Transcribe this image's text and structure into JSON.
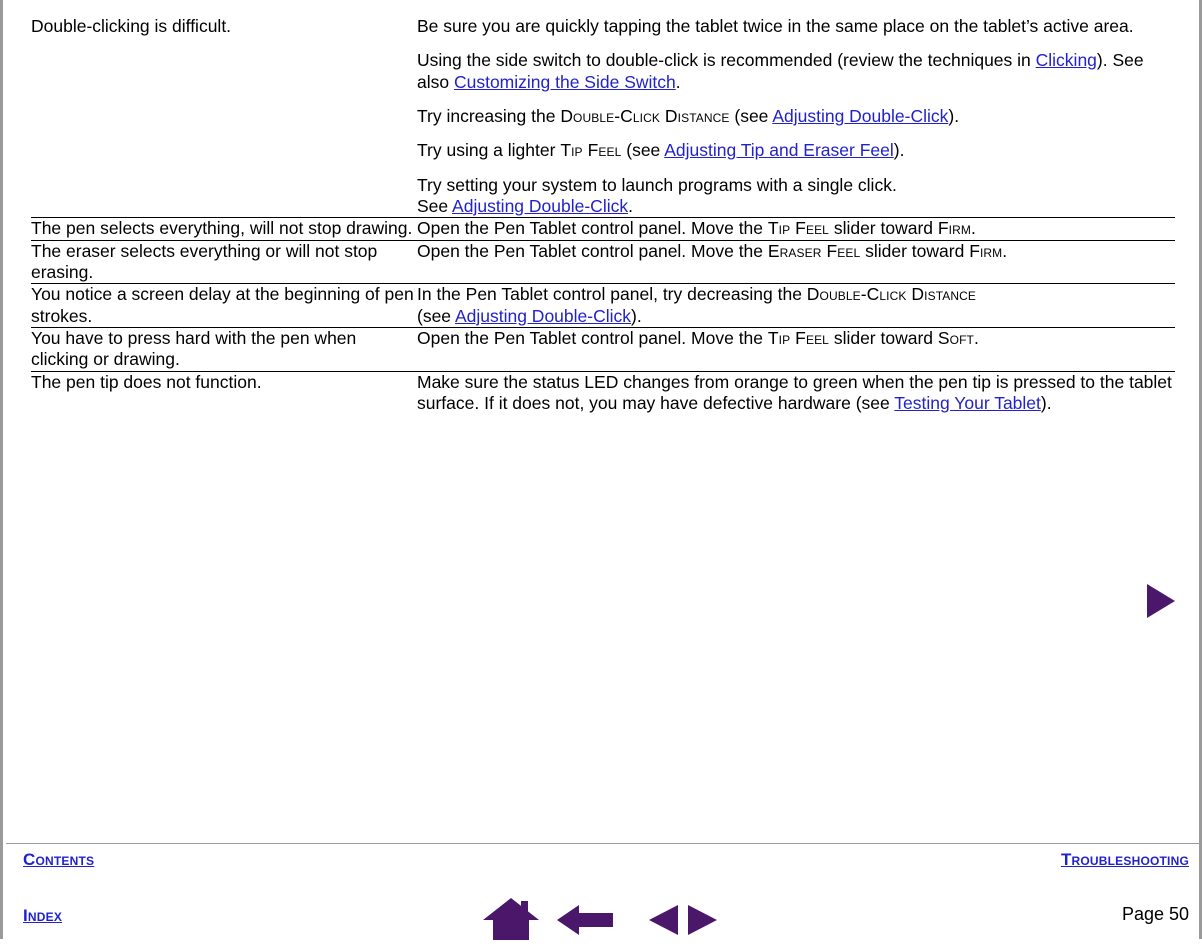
{
  "document": {
    "page_number_label": "Page  50",
    "accent_purple": "#4b176b",
    "link_blue": "#2222cc",
    "border_gray": "#9a9a9a"
  },
  "table": {
    "rows": [
      {
        "symptom": "Double-clicking is difficult.",
        "solutions": [
          {
            "segments": [
              {
                "type": "text",
                "text": "Be sure you are quickly tapping the tablet twice in the same place on the tablet’s active area."
              }
            ]
          },
          {
            "segments": [
              {
                "type": "text",
                "text": "Using the side switch to double-click is recommended (review the techniques in "
              },
              {
                "type": "link",
                "text": "Clicking"
              },
              {
                "type": "text",
                "text": ").  See also "
              },
              {
                "type": "link",
                "text": "Customizing the Side Switch"
              },
              {
                "type": "text",
                "text": "."
              }
            ]
          },
          {
            "segments": [
              {
                "type": "text",
                "text": "Try increasing the "
              },
              {
                "type": "smallcaps",
                "text": "Double-Click Distance"
              },
              {
                "type": "text",
                "text": " (see "
              },
              {
                "type": "link",
                "text": "Adjusting Double-Click"
              },
              {
                "type": "text",
                "text": ")."
              }
            ]
          },
          {
            "segments": [
              {
                "type": "text",
                "text": "Try using a lighter "
              },
              {
                "type": "smallcaps",
                "text": "Tip Feel"
              },
              {
                "type": "text",
                "text": " (see "
              },
              {
                "type": "link",
                "text": "Adjusting Tip and Eraser Feel"
              },
              {
                "type": "text",
                "text": ")."
              }
            ]
          },
          {
            "segments": [
              {
                "type": "text",
                "text": "Try setting your system to launch programs with a single click."
              },
              {
                "type": "break"
              },
              {
                "type": "text",
                "text": "See "
              },
              {
                "type": "link",
                "text": "Adjusting Double-Click"
              },
              {
                "type": "text",
                "text": "."
              }
            ]
          }
        ]
      },
      {
        "symptom": "The pen selects everything, will not stop drawing.",
        "solutions": [
          {
            "segments": [
              {
                "type": "text",
                "text": "Open the Pen Tablet control panel.  Move the "
              },
              {
                "type": "smallcaps",
                "text": "Tip Feel"
              },
              {
                "type": "text",
                "text": " slider toward "
              },
              {
                "type": "smallcaps",
                "text": "Firm"
              },
              {
                "type": "text",
                "text": "."
              }
            ]
          }
        ]
      },
      {
        "symptom": "The eraser selects everything or will not stop erasing.",
        "solutions": [
          {
            "segments": [
              {
                "type": "text",
                "text": "Open the Pen Tablet control panel. Move the "
              },
              {
                "type": "smallcaps",
                "text": "Eraser Feel"
              },
              {
                "type": "text",
                "text": " slider toward "
              },
              {
                "type": "smallcaps",
                "text": "Firm"
              },
              {
                "type": "text",
                "text": "."
              }
            ]
          }
        ]
      },
      {
        "symptom": "You notice a screen delay at the beginning of pen strokes.",
        "solutions": [
          {
            "segments": [
              {
                "type": "text",
                "text": "In the Pen Tablet control panel, try decreasing the "
              },
              {
                "type": "smallcaps",
                "text": "Double-Click Distance"
              },
              {
                "type": "break"
              },
              {
                "type": "text",
                "text": "(see "
              },
              {
                "type": "link",
                "text": "Adjusting Double-Click"
              },
              {
                "type": "text",
                "text": ")."
              }
            ]
          }
        ]
      },
      {
        "symptom": "You have to press hard with the pen when clicking or drawing.",
        "solutions": [
          {
            "segments": [
              {
                "type": "text",
                "text": "Open the Pen Tablet control panel.  Move the "
              },
              {
                "type": "smallcaps",
                "text": "Tip Feel"
              },
              {
                "type": "text",
                "text": " slider toward "
              },
              {
                "type": "smallcaps",
                "text": "Soft"
              },
              {
                "type": "text",
                "text": "."
              }
            ]
          }
        ]
      },
      {
        "symptom": "The pen tip does not function.",
        "solutions": [
          {
            "segments": [
              {
                "type": "text",
                "text": "Make sure the status LED changes from orange to green when the pen tip is pressed to the tablet surface.  If it does not, you may have defective hardware (see "
              },
              {
                "type": "link",
                "text": "Testing Your Tablet"
              },
              {
                "type": "text",
                "text": ")."
              }
            ]
          }
        ]
      }
    ]
  },
  "footer": {
    "contents_label": "Contents",
    "index_label": "Index",
    "troubleshooting_label": "Troubleshooting",
    "page_label": "Page  50",
    "icons": {
      "home": "home-icon",
      "back": "back-arrow-icon",
      "prev_page": "previous-page-icon",
      "next_page": "next-page-icon"
    }
  },
  "body_marker": {
    "next_triangle": "next-triangle-icon"
  }
}
